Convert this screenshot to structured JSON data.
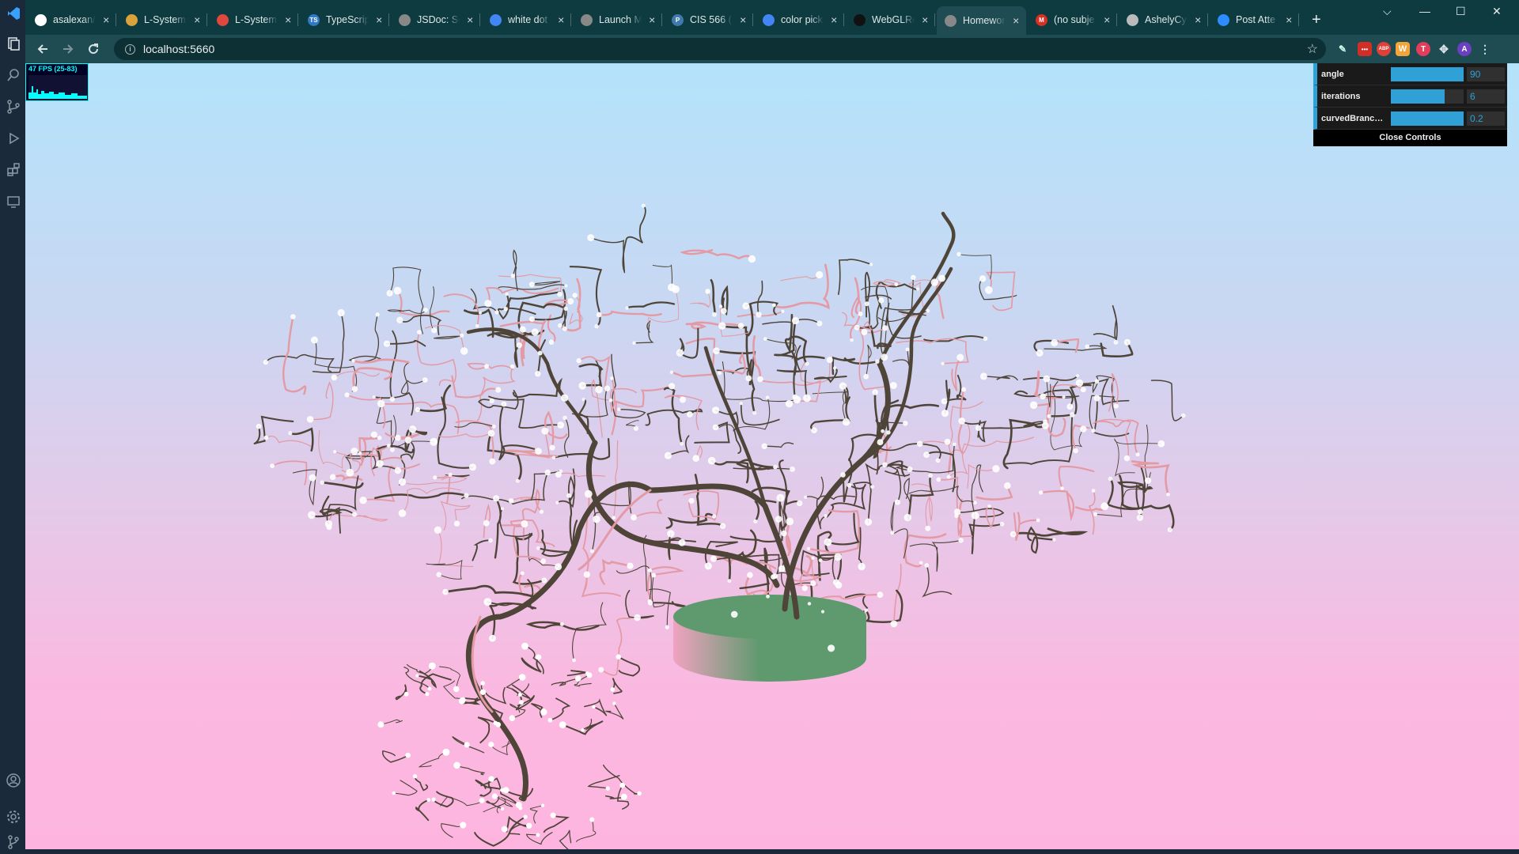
{
  "browser": {
    "tabs": [
      {
        "label": "asalexan/",
        "icon": "github-icon",
        "color": "#ffffff"
      },
      {
        "label": "L-System",
        "icon": "shield-icon",
        "color": "#d9a23a"
      },
      {
        "label": "L-System",
        "icon": "circle-icon",
        "color": "#e0483f"
      },
      {
        "label": "TypeScrip",
        "icon": "typescript-icon",
        "color": "#3178c6",
        "text": "TS"
      },
      {
        "label": "JSDoc: Sc",
        "icon": "globe-icon",
        "color": "#888888"
      },
      {
        "label": "white dot",
        "icon": "google-icon",
        "color": "#4285f4"
      },
      {
        "label": "Launch M",
        "icon": "globe-icon",
        "color": "#888888"
      },
      {
        "label": "CIS 566 (",
        "icon": "piazza-icon",
        "color": "#3e7aab",
        "text": "P"
      },
      {
        "label": "color pick",
        "icon": "google-icon",
        "color": "#4285f4"
      },
      {
        "label": "WebGLRe",
        "icon": "github-dark-icon",
        "color": "#111111"
      },
      {
        "label": "Homewor",
        "icon": "globe-icon",
        "color": "#888888",
        "active": true
      },
      {
        "label": "(no subje",
        "icon": "gmail-icon",
        "color": "#d93025",
        "text": "M"
      },
      {
        "label": "AshelyCy",
        "icon": "doc-icon",
        "color": "#bbbbbb"
      },
      {
        "label": "Post Atte",
        "icon": "zoom-icon",
        "color": "#2d8cff"
      }
    ],
    "url": "localhost:5660"
  },
  "stats": {
    "fps_text": "47 FPS (25-83)"
  },
  "gui": {
    "controls": [
      {
        "label": "angle",
        "value": "90",
        "fill": 1.0
      },
      {
        "label": "iterations",
        "value": "6",
        "fill": 0.74
      },
      {
        "label": "curvedBranchPr...",
        "value": "0.2",
        "fill": 1.0
      }
    ],
    "close_label": "Close Controls"
  },
  "scene": {
    "pot_color_left": "#f0a3c0",
    "pot_color_right": "#5e9a6e",
    "branch_color": "#4e4538",
    "branch_highlight": "#e39aa4",
    "blossom_color": "#ffffff"
  }
}
